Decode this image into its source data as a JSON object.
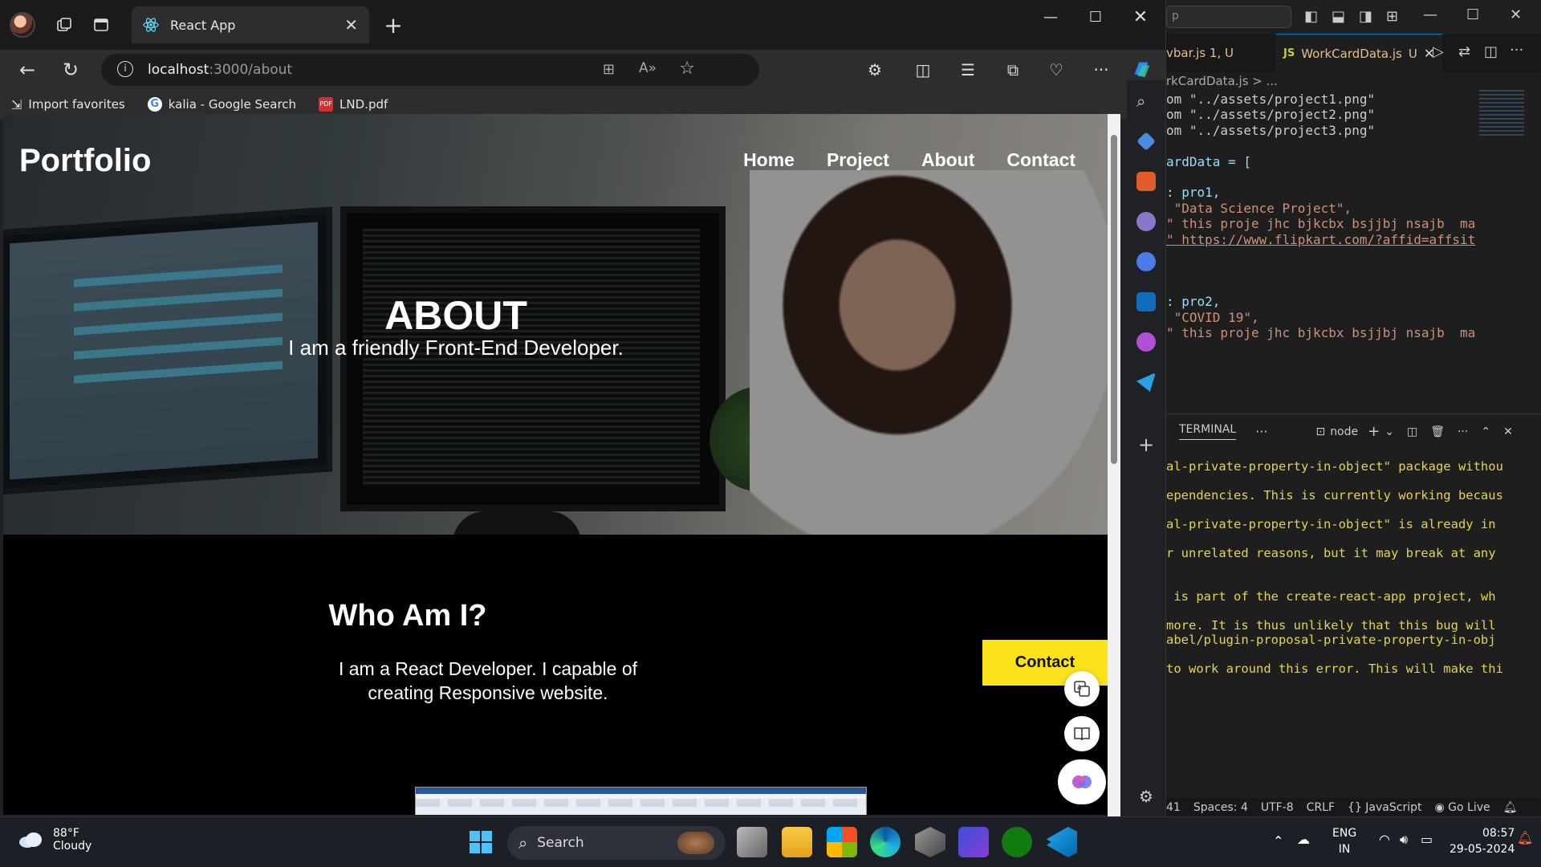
{
  "browser": {
    "tab_title": "React App",
    "url_host": "localhost",
    "url_path": ":3000/about",
    "favorites": [
      {
        "label": "Import favorites"
      },
      {
        "label": "kalia - Google Search"
      },
      {
        "label": "LND.pdf"
      }
    ]
  },
  "site": {
    "logo": "Portfolio",
    "nav": [
      "Home",
      "Project",
      "About",
      "Contact"
    ],
    "hero_title": "ABOUT",
    "hero_subtitle": "I am a friendly Front-End Developer.",
    "section_title": "Who Am I?",
    "section_text": "I am a React Developer. I capable of creating Responsive website.",
    "contact_button": "Contact"
  },
  "vscode": {
    "search_text": "p",
    "tab1": "vbar.js 1, U",
    "tab2_badge": "JS",
    "tab2": "WorkCardData.js",
    "tab2_status": "U",
    "breadcrumb": "rkCardData.js > ...",
    "code": [
      "om \"../assets/project1.png\"",
      "om \"../assets/project2.png\"",
      "om \"../assets/project3.png\"",
      "",
      "ardData = [",
      "",
      ": pro1,",
      " \"Data Science Project\",",
      "\" this proje jhc bjkcbx bsjjbj nsajb  ma",
      "\" https://www.flipkart.com/?affid=affsit",
      "",
      "",
      "",
      ": pro2,",
      " \"COVID 19\",",
      "\" this proje jhc bjkcbx bsjjbj nsajb  ma"
    ],
    "terminal_tab": "TERMINAL",
    "terminal_shell": "node",
    "terminal": [
      "al-private-property-in-object\" package withou",
      "ependencies. This is currently working becaus",
      "al-private-property-in-object\" is already in",
      "r unrelated reasons, but it may break at any",
      "",
      " is part of the create-react-app project, wh",
      "",
      "more. It is thus unlikely that this bug will",
      "abel/plugin-proposal-private-property-in-obj",
      "",
      "to work around this error. This will make thi"
    ],
    "status": {
      "pos": "41",
      "spaces": "Spaces: 4",
      "encoding": "UTF-8",
      "eol": "CRLF",
      "lang": "JavaScript",
      "golive": "Go Live"
    }
  },
  "taskbar": {
    "temp": "88°F",
    "condition": "Cloudy",
    "search": "Search",
    "lang1": "ENG",
    "lang2": "IN",
    "time": "08:57",
    "date": "29-05-2024"
  }
}
